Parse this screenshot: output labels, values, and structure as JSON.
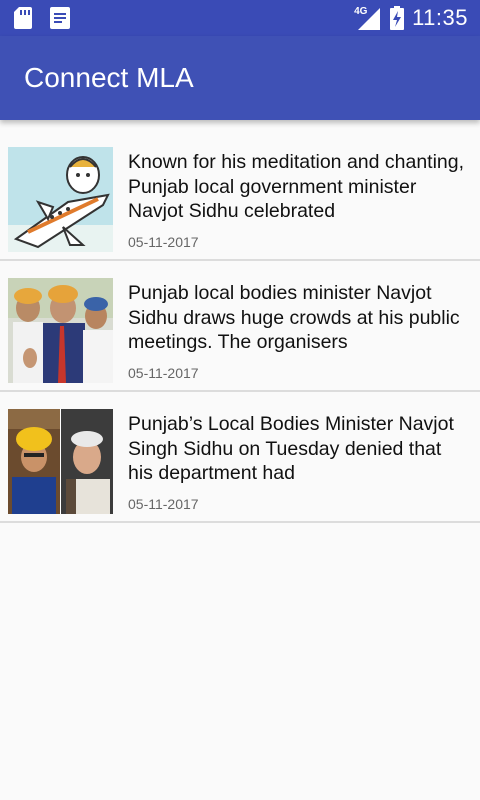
{
  "status_bar": {
    "time": "11:35",
    "network": "4G",
    "icons": [
      "sd-card-icon",
      "notification-doc-icon",
      "signal-icon",
      "battery-charging-icon"
    ]
  },
  "app_bar": {
    "title": "Connect MLA"
  },
  "news": [
    {
      "headline": "Known for his meditation and chanting, Punjab local government minister Navjot Sidhu celebrated",
      "date": "05-11-2017"
    },
    {
      "headline": "Punjab local bodies minister Navjot Sidhu draws huge crowds at his public meetings. The organisers",
      "date": "05-11-2017"
    },
    {
      "headline": "Punjab’s Local Bodies Minister Navjot Singh Sidhu on Tuesday denied that his department had",
      "date": "05-11-2017"
    }
  ],
  "colors": {
    "status_bar": "#3a4bb6",
    "app_bar": "#3f51b5",
    "background": "#fafafa",
    "divider": "#dcdcdc"
  }
}
